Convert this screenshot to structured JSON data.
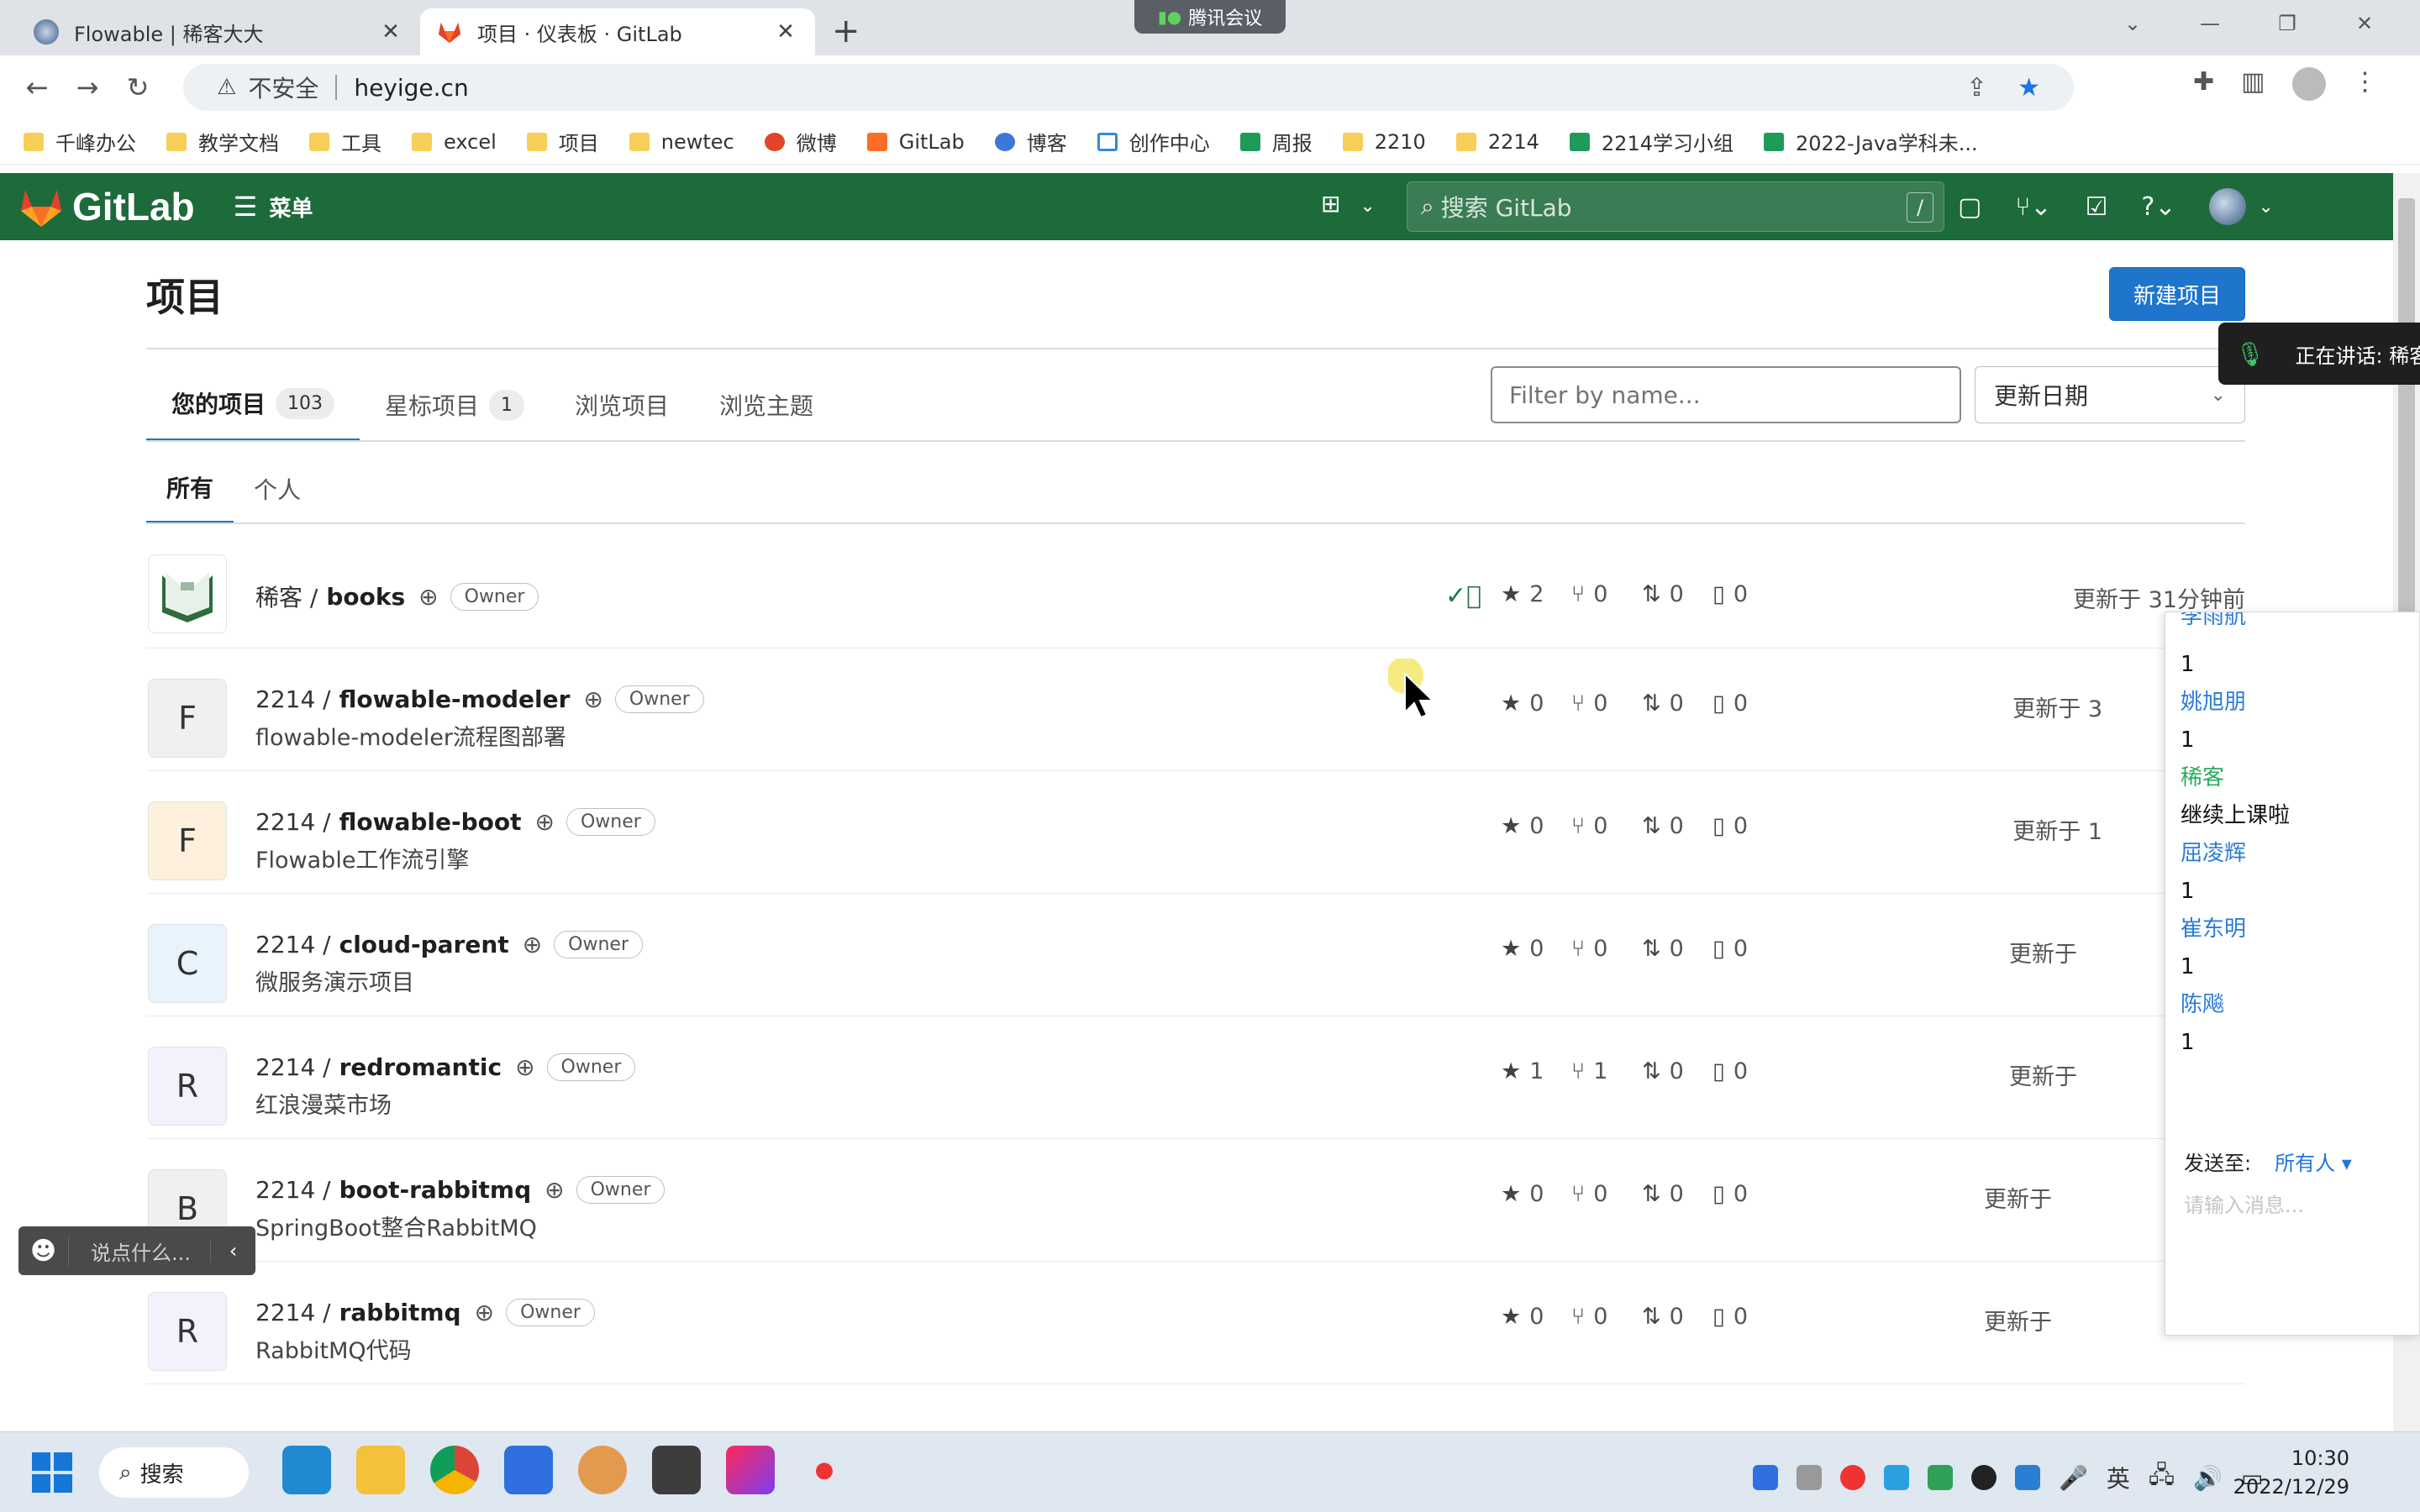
{
  "browser": {
    "tabs": [
      {
        "title": "Flowable | 稀客大大",
        "active": false
      },
      {
        "title": "项目 · 仪表板 · GitLab",
        "active": true
      }
    ],
    "meeting_pill": "腾讯会议",
    "insecure_label": "不安全",
    "url": "heyige.cn",
    "bookmarks": [
      "千峰办公",
      "教学文档",
      "工具",
      "excel",
      "项目",
      "newtec",
      "微博",
      "GitLab",
      "博客",
      "创作中心",
      "周报",
      "2210",
      "2214",
      "2214学习小组",
      "2022-Java学科未..."
    ]
  },
  "gitlab": {
    "logo_text": "GitLab",
    "menu_label": "菜单",
    "search_placeholder": "搜索 GitLab",
    "search_shortcut": "/"
  },
  "page": {
    "title": "项目",
    "new_project_label": "新建项目",
    "tabs": [
      {
        "label": "您的项目",
        "count": "103"
      },
      {
        "label": "星标项目",
        "count": "1"
      },
      {
        "label": "浏览项目"
      },
      {
        "label": "浏览主题"
      }
    ],
    "filter_placeholder": "Filter by name...",
    "sort_label": "更新日期",
    "subtabs": [
      "所有",
      "个人"
    ],
    "projects": [
      {
        "avatar": "",
        "namespace": "稀客 /",
        "name": "books",
        "role": "Owner",
        "desc": "",
        "stars": "2",
        "forks": "0",
        "mrs": "0",
        "issues": "0",
        "updated": "更新于 31分钟前"
      },
      {
        "avatar": "F",
        "namespace": "2214 /",
        "name": "flowable-modeler",
        "role": "Owner",
        "desc": "flowable-modeler流程图部署",
        "stars": "0",
        "forks": "0",
        "mrs": "0",
        "issues": "0",
        "updated": "更新于 3"
      },
      {
        "avatar": "F",
        "namespace": "2214 /",
        "name": "flowable-boot",
        "role": "Owner",
        "desc": "Flowable工作流引擎",
        "stars": "0",
        "forks": "0",
        "mrs": "0",
        "issues": "0",
        "updated": "更新于 1"
      },
      {
        "avatar": "C",
        "namespace": "2214 /",
        "name": "cloud-parent",
        "role": "Owner",
        "desc": "微服务演示项目",
        "stars": "0",
        "forks": "0",
        "mrs": "0",
        "issues": "0",
        "updated": "更新于"
      },
      {
        "avatar": "R",
        "namespace": "2214 /",
        "name": "redromantic",
        "role": "Owner",
        "desc": "红浪漫菜市场",
        "stars": "1",
        "forks": "1",
        "mrs": "0",
        "issues": "0",
        "updated": "更新于"
      },
      {
        "avatar": "B",
        "namespace": "2214 /",
        "name": "boot-rabbitmq",
        "role": "Owner",
        "desc": "SpringBoot整合RabbitMQ",
        "stars": "0",
        "forks": "0",
        "mrs": "0",
        "issues": "0",
        "updated": "更新于"
      },
      {
        "avatar": "R",
        "namespace": "2214 /",
        "name": "rabbitmq",
        "role": "Owner",
        "desc": "RabbitMQ代码",
        "stars": "0",
        "forks": "0",
        "mrs": "0",
        "issues": "0",
        "updated": "更新于"
      }
    ]
  },
  "meeting": {
    "speaking": "正在讲话: 稀客",
    "chat_cut_name": "李雨航",
    "chat_messages": [
      {
        "name": "",
        "text": "1"
      },
      {
        "name": "姚旭朋",
        "text": "1"
      },
      {
        "name": "稀客",
        "text": "继续上课啦",
        "self": true
      },
      {
        "name": "屈凌辉",
        "text": "1"
      },
      {
        "name": "崔东明",
        "text": "1"
      },
      {
        "name": "陈飚",
        "text": "1"
      }
    ],
    "send_to_label": "发送至:",
    "send_to_value": "所有人 ▾",
    "input_placeholder": "请输入消息...",
    "bubble_placeholder": "说点什么..."
  },
  "taskbar": {
    "search_label": "搜索",
    "ime": "英",
    "time": "10:30",
    "date": "2022/12/29"
  },
  "colors": {
    "gitlab_header": "#1d6a3b",
    "primary_button": "#1f75cb",
    "ci_success": "#217645"
  }
}
